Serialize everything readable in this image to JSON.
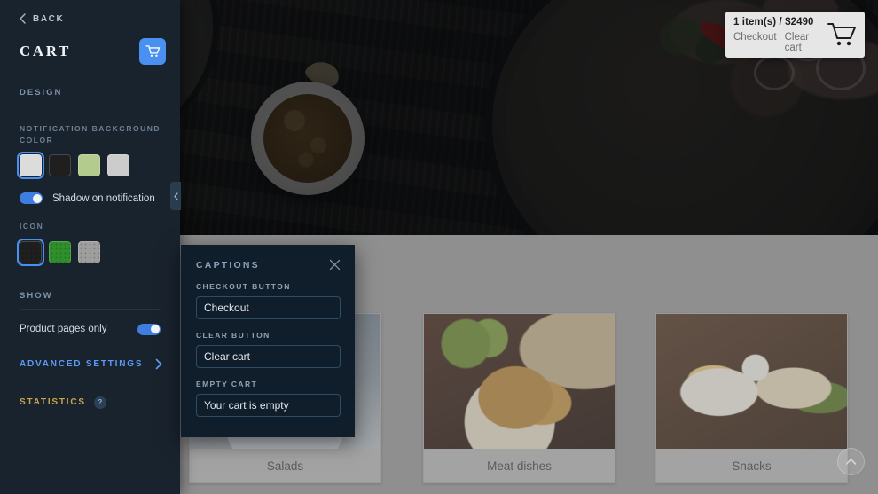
{
  "panel": {
    "back_label": "BACK",
    "back_icon": "chevron-left-icon",
    "title": "CART",
    "cart_button_icon": "shopping-cart-icon",
    "accent_color": "#4a90f0",
    "sections": {
      "design": "DESIGN",
      "show": "SHOW"
    },
    "notification_bg": {
      "label": "NOTIFICATION BACKGROUND COLOR",
      "swatches": [
        {
          "name": "white",
          "hex": "#dcdcdc",
          "selected": true,
          "pattern": false
        },
        {
          "name": "dark",
          "hex": "#1f1f1f",
          "selected": false,
          "pattern": false
        },
        {
          "name": "green",
          "hex": "#b3cc8e",
          "selected": false,
          "pattern": false
        },
        {
          "name": "gray",
          "hex": "#cccccc",
          "selected": false,
          "pattern": false
        }
      ]
    },
    "shadow_toggle": {
      "label": "Shadow on notification",
      "on": true
    },
    "icon_group": {
      "label": "ICON",
      "swatches": [
        {
          "name": "dark",
          "hex": "#1f1f1f",
          "selected": true,
          "pattern": true
        },
        {
          "name": "green",
          "hex": "#2f8f2a",
          "selected": false,
          "pattern": true
        },
        {
          "name": "gray",
          "hex": "#9e9e9e",
          "selected": false,
          "pattern": true
        }
      ]
    },
    "product_pages_only": {
      "label": "Product pages only",
      "on": true
    },
    "advanced_settings": {
      "label": "ADVANCED SETTINGS",
      "icon": "chevron-right-icon"
    },
    "statistics": {
      "label": "STATISTICS",
      "badge": "?",
      "color": "#c9a44e"
    },
    "collapse_handle_icon": "chevron-left-icon"
  },
  "captions_modal": {
    "title": "CAPTIONS",
    "close_icon": "close-icon",
    "fields": [
      {
        "label": "CHECKOUT BUTTON",
        "value": "Checkout"
      },
      {
        "label": "CLEAR BUTTON",
        "value": "Clear cart"
      },
      {
        "label": "EMPTY CART",
        "value": "Your cart is empty"
      }
    ]
  },
  "cart_notification": {
    "summary": "1 item(s) / $2490",
    "checkout_label": "Checkout",
    "clear_label": "Clear cart",
    "cart_icon": "shopping-cart-icon",
    "background": "#e6e6e6"
  },
  "site": {
    "hero_alt": "steak-plate-hero-image",
    "products": [
      {
        "title": "Salads",
        "image": "salad-plate-image"
      },
      {
        "title": "Meat dishes",
        "image": "sausages-board-image"
      },
      {
        "title": "Snacks",
        "image": "fries-sandwich-board-image"
      }
    ],
    "scroll_top_icon": "chevron-up-icon"
  }
}
